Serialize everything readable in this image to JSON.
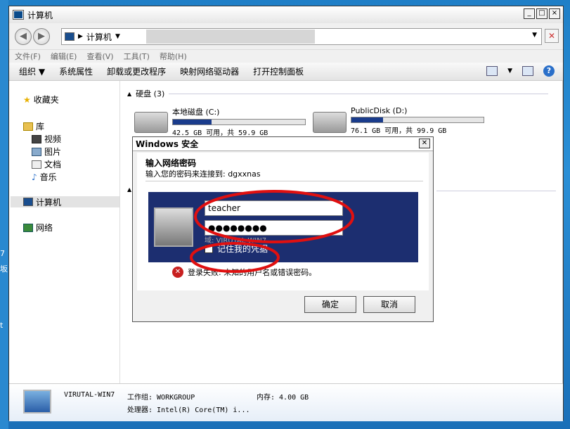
{
  "window": {
    "title": "计算机"
  },
  "address": {
    "path": "计算机"
  },
  "desktop_side_chars": [
    "7",
    "坂",
    "t"
  ],
  "menu": [
    "文件(F)",
    "编辑(E)",
    "查看(V)",
    "工具(T)",
    "帮助(H)"
  ],
  "commands": [
    "组织",
    "系统属性",
    "卸载或更改程序",
    "映射网络驱动器",
    "打开控制面板"
  ],
  "nav": {
    "favorites": "收藏夹",
    "libraries": "库",
    "lib_items": [
      "视频",
      "图片",
      "文档",
      "音乐"
    ],
    "computer": "计算机",
    "network": "网络"
  },
  "content": {
    "group_label": "硬盘 (3)",
    "drives": [
      {
        "name": "本地磁盘 (C:)",
        "space": "42.5 GB 可用，共 59.9 GB",
        "used_fraction": 0.29
      },
      {
        "name": "PublicDisk (D:)",
        "space": "76.1 GB 可用，共 99.9 GB",
        "used_fraction": 0.24
      }
    ]
  },
  "details": {
    "computer_name": "VIRUTAL-WIN7",
    "workgroup": "工作组: WORKGROUP",
    "memory": "内存: 4.00 GB",
    "processor": "处理器: Intel(R) Core(TM) i..."
  },
  "dialog": {
    "title": "Windows 安全",
    "heading": "输入网络密码",
    "subtitle": "输入您的密码来连接到: dgxxnas",
    "username": "teacher",
    "password": "●●●●●●●●",
    "domain_partial": "域: VIRUTAL-WIN7",
    "remember": "记住我的凭据",
    "remember_checked": true,
    "error": "登录失败: 未知的用户名或错误密码。",
    "ok": "确定",
    "cancel": "取消"
  }
}
